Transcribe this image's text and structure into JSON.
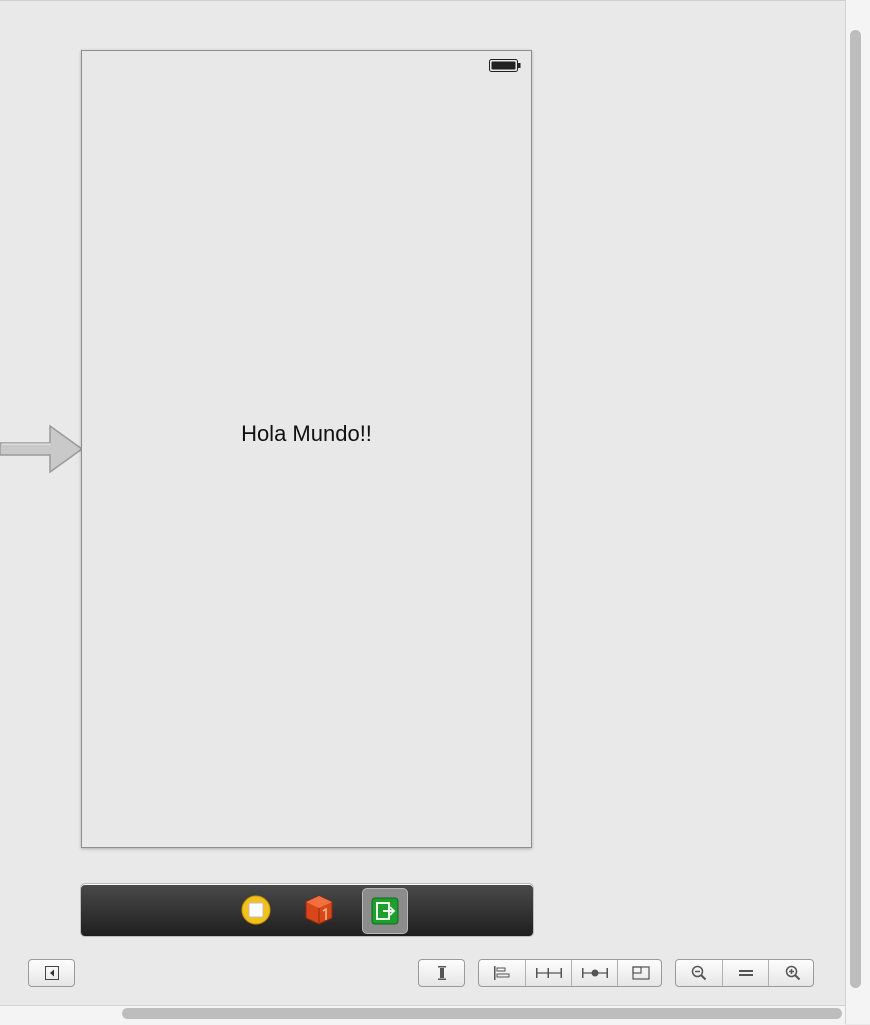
{
  "scene": {
    "label_text": "Hola Mundo!!"
  },
  "colors": {
    "canvas_bg": "#e9e9e9",
    "scene_bg": "#e8e8e8",
    "dock_bg": "#2e2e2e",
    "first_responder": "#f4c11a",
    "view_controller": "#d9461a",
    "exit": "#1f9e2e"
  },
  "icons": {
    "entry_arrow": "entry-point-arrow-icon",
    "battery": "battery-icon",
    "dock": [
      "view-controller-icon",
      "first-responder-icon",
      "exit-icon"
    ],
    "toolbar": [
      "toggle-document-outline-icon",
      "issue-icon",
      "align-icon",
      "pin-icon",
      "resolve-auto-layout-icon",
      "resizing-icon",
      "zoom-out-icon",
      "zoom-actual-size-icon",
      "zoom-in-icon"
    ]
  }
}
